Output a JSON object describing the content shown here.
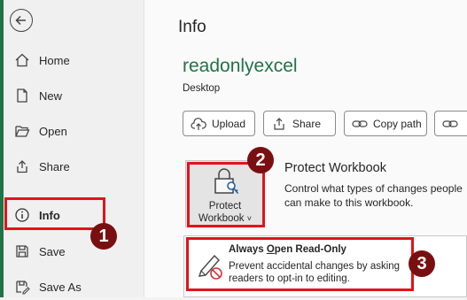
{
  "sidebar": {
    "back_label": "Back",
    "items": [
      {
        "label": "Home",
        "icon": "home-icon"
      },
      {
        "label": "New",
        "icon": "new-document-icon"
      },
      {
        "label": "Open",
        "icon": "folder-open-icon"
      },
      {
        "label": "Share",
        "icon": "share-icon"
      },
      {
        "label": "Info",
        "icon": "info-icon"
      },
      {
        "label": "Save",
        "icon": "save-icon"
      },
      {
        "label": "Save As",
        "icon": "save-as-icon"
      }
    ],
    "active": "Info"
  },
  "page": {
    "title": "Info",
    "document_name": "readonlyexcel",
    "document_location": "Desktop"
  },
  "actions": {
    "upload": "Upload",
    "share": "Share",
    "copy_path": "Copy path"
  },
  "protect": {
    "button_line1": "Protect",
    "button_line2": "Workbook",
    "chevron": "˅",
    "heading": "Protect Workbook",
    "description": "Control what types of changes people can make to this workbook."
  },
  "dropdown": {
    "item_title_pre": "Always ",
    "item_title_underlined": "O",
    "item_title_post": "pen Read-Only",
    "item_description": "Prevent accidental changes by asking readers to opt-in to editing."
  },
  "annotations": {
    "step1": "1",
    "step2": "2",
    "step3": "3"
  },
  "colors": {
    "accent": "#217346",
    "highlight": "#e0141b",
    "badge": "#7a0f12"
  }
}
